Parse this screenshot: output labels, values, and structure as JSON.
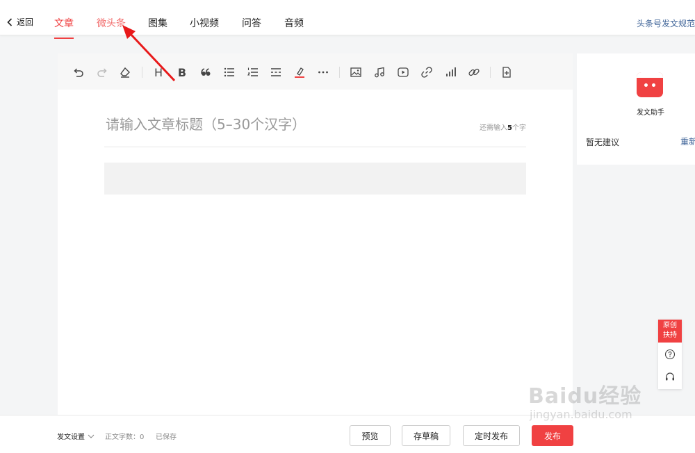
{
  "topbar": {
    "back_label": "返回",
    "tabs": [
      {
        "label": "文章",
        "state": "active"
      },
      {
        "label": "微头条",
        "state": "hover"
      },
      {
        "label": "图集",
        "state": "normal"
      },
      {
        "label": "小视频",
        "state": "normal"
      },
      {
        "label": "问答",
        "state": "normal"
      },
      {
        "label": "音频",
        "state": "normal"
      }
    ],
    "rules_link": "头条号发文规范"
  },
  "toolbar": {
    "icons": [
      "undo-icon",
      "redo-icon",
      "eraser-icon",
      "heading-icon",
      "bold-icon",
      "quote-icon",
      "bullet-list-icon",
      "numbered-list-icon",
      "divider-icon",
      "highlight-icon",
      "more-icon",
      "image-icon",
      "music-icon",
      "video-icon",
      "link-icon",
      "chart-icon",
      "chain-icon",
      "insert-doc-icon"
    ],
    "heading_glyph": "H",
    "bold_glyph": "B"
  },
  "editor": {
    "title_placeholder": "请输入文章标题（5–30个汉字）",
    "title_value": "",
    "char_hint_prefix": "还需输入",
    "char_hint_count": "5",
    "char_hint_suffix": "个字"
  },
  "assistant": {
    "label": "发文助手",
    "no_suggestion": "暂无建议",
    "refresh": "重新检测"
  },
  "float_panel": {
    "original_support": "原创扶持"
  },
  "bottombar": {
    "settings": "发文设置",
    "word_count_label": "正文字数：",
    "word_count": "0",
    "saved_status": "已保存",
    "buttons": {
      "preview": "预览",
      "draft": "存草稿",
      "schedule": "定时发布",
      "publish": "发布"
    }
  },
  "watermark": {
    "brand": "Baidu经验",
    "url": "jingyan.baidu.com"
  },
  "colors": {
    "accent": "#f04142",
    "link": "#406599",
    "annotation_arrow": "#e8191a"
  }
}
